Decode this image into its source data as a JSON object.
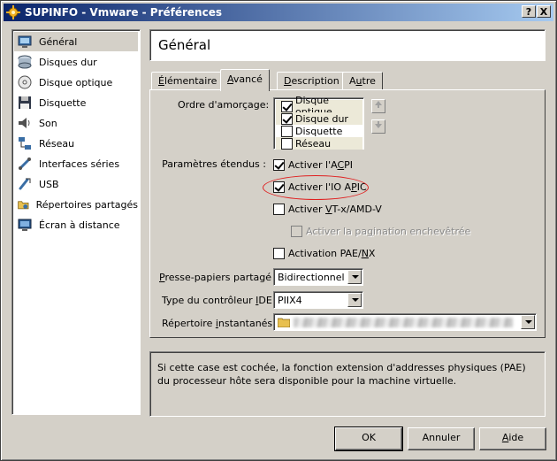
{
  "window": {
    "title": "SUPINFO - Vmware - Préférences",
    "help_btn": "?",
    "close_btn": "X"
  },
  "sidebar": {
    "items": [
      {
        "label": "Général",
        "icon": "monitor-icon",
        "selected": true
      },
      {
        "label": "Disques dur",
        "icon": "hard-disk-icon"
      },
      {
        "label": "Disque optique",
        "icon": "optical-disc-icon"
      },
      {
        "label": "Disquette",
        "icon": "floppy-icon"
      },
      {
        "label": "Son",
        "icon": "speaker-icon"
      },
      {
        "label": "Réseau",
        "icon": "network-icon"
      },
      {
        "label": "Interfaces séries",
        "icon": "serial-port-icon"
      },
      {
        "label": "USB",
        "icon": "usb-icon"
      },
      {
        "label": "Répertoires partagés",
        "icon": "shared-folder-icon"
      },
      {
        "label": "Écran à distance",
        "icon": "remote-display-icon"
      }
    ]
  },
  "header": {
    "title": "Général"
  },
  "tabs": [
    {
      "label": "Élémentaire",
      "ul": "É",
      "rest": "lémentaire"
    },
    {
      "label": "Avancé",
      "ul": "A",
      "rest": "vancé",
      "active": true
    },
    {
      "label": "Description",
      "ul": "D",
      "rest": "escription"
    },
    {
      "label": "Autre",
      "pre": "A",
      "ul": "u",
      "rest": "tre"
    }
  ],
  "advanced": {
    "boot_order_label": "Ordre d'amorçage:",
    "boot_items": [
      {
        "label": "Disque optique",
        "checked": true
      },
      {
        "label": "Disque dur",
        "checked": true
      },
      {
        "label": "Disquette",
        "checked": false
      },
      {
        "label": "Réseau",
        "checked": false
      }
    ],
    "extended_label": "Paramètres étendus :",
    "acpi": {
      "pre": "Activer l'A",
      "ul": "C",
      "rest": "PI",
      "checked": true
    },
    "ioapic": {
      "pre": "Activer l'IO A",
      "ul": "P",
      "rest": "IC",
      "checked": true
    },
    "vtx": {
      "pre": "Activer ",
      "ul": "V",
      "rest": "T-x/AMD-V",
      "checked": false
    },
    "nested": {
      "pre": "Activer la pa",
      "ul": "g",
      "rest": "ination enchevêtrée",
      "checked": false,
      "disabled": true
    },
    "pae": {
      "pre": "Activation PAE/",
      "ul": "N",
      "rest": "X",
      "checked": false
    },
    "clipboard": {
      "pre": "",
      "ul": "P",
      "rest": "resse-papiers partagé :",
      "value": "Bidirectionnel"
    },
    "ide": {
      "pre": "Type du contrôleur ",
      "ul": "I",
      "rest": "DE :",
      "value": "PIIX4"
    },
    "snapshot": {
      "pre": "Répertoire ",
      "ul": "i",
      "rest": "nstantanés :"
    }
  },
  "description": "Si cette case est cochée, la fonction extension d'addresses physiques (PAE) du processeur hôte sera disponible pour la machine virtuelle.",
  "buttons": {
    "ok": "OK",
    "cancel": "Annuler",
    "help_ul": "A",
    "help_rest": "ide"
  },
  "colors": {
    "title_start": "#0a246a",
    "title_end": "#a6caf0",
    "highlight": "#e02020"
  }
}
